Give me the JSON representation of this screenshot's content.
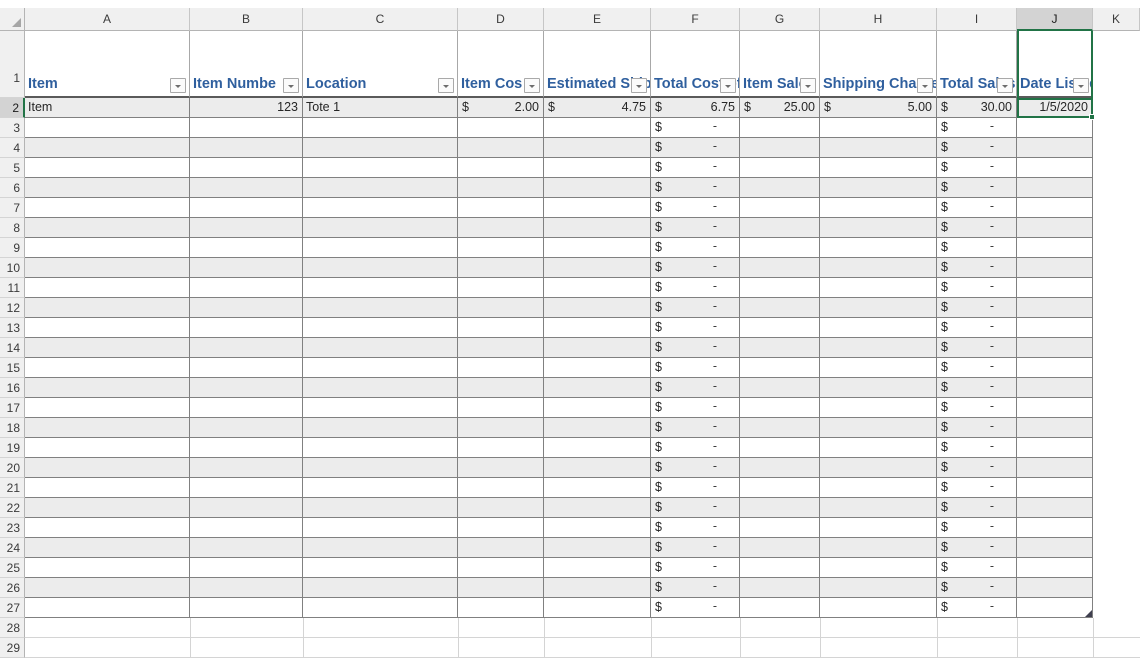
{
  "app": {
    "type": "spreadsheet"
  },
  "grid": {
    "corner_icon": "select-all-triangle-icon",
    "column_letters": [
      "A",
      "B",
      "C",
      "D",
      "E",
      "F",
      "G",
      "H",
      "I",
      "J",
      "K"
    ],
    "selected_column": "J",
    "row_numbers": [
      1,
      2,
      3,
      4,
      5,
      6,
      7,
      8,
      9,
      10,
      11,
      12,
      13,
      14,
      15,
      16,
      17,
      18,
      19,
      20,
      21,
      22,
      23,
      24,
      25,
      26,
      27,
      28,
      29
    ],
    "selected_row": 2
  },
  "table": {
    "headers": [
      {
        "col": "A",
        "label": "Item",
        "align": "left",
        "filter": true
      },
      {
        "col": "B",
        "label": "Item Numbe",
        "align": "left",
        "filter": true
      },
      {
        "col": "C",
        "label": "Location",
        "align": "left",
        "filter": true
      },
      {
        "col": "D",
        "label": "Item Cos",
        "align": "left",
        "filter": true
      },
      {
        "col": "E",
        "label": "Estimated Shipping Costs",
        "align": "right",
        "filter": true
      },
      {
        "col": "F",
        "label": "Total Cost of Item",
        "align": "right",
        "filter": true
      },
      {
        "col": "G",
        "label": "Item Sales Price",
        "align": "right",
        "filter": true
      },
      {
        "col": "H",
        "label": "Shipping Charged",
        "align": "right",
        "filter": true
      },
      {
        "col": "I",
        "label": "Total Sales Price",
        "align": "right",
        "filter": true
      },
      {
        "col": "J",
        "label": "Date Listed",
        "align": "center",
        "filter": true
      }
    ],
    "rows": [
      {
        "row": 2,
        "item": "Item",
        "item_number": "123",
        "location": "Tote 1",
        "item_cost": "2.00",
        "estimated_shipping_costs": "4.75",
        "total_cost_of_item": "6.75",
        "item_sales_price": "25.00",
        "shipping_charged": "5.00",
        "total_sales_price": "30.00",
        "date_listed": "1/5/2020"
      },
      {
        "row": 3,
        "item": "",
        "item_number": "",
        "location": "",
        "item_cost": "",
        "estimated_shipping_costs": "",
        "total_cost_of_item": "-",
        "item_sales_price": "",
        "shipping_charged": "",
        "total_sales_price": "-",
        "date_listed": ""
      },
      {
        "row": 4,
        "item": "",
        "item_number": "",
        "location": "",
        "item_cost": "",
        "estimated_shipping_costs": "",
        "total_cost_of_item": "-",
        "item_sales_price": "",
        "shipping_charged": "",
        "total_sales_price": "-",
        "date_listed": ""
      },
      {
        "row": 5,
        "item": "",
        "item_number": "",
        "location": "",
        "item_cost": "",
        "estimated_shipping_costs": "",
        "total_cost_of_item": "-",
        "item_sales_price": "",
        "shipping_charged": "",
        "total_sales_price": "-",
        "date_listed": ""
      },
      {
        "row": 6,
        "item": "",
        "item_number": "",
        "location": "",
        "item_cost": "",
        "estimated_shipping_costs": "",
        "total_cost_of_item": "-",
        "item_sales_price": "",
        "shipping_charged": "",
        "total_sales_price": "-",
        "date_listed": ""
      },
      {
        "row": 7,
        "item": "",
        "item_number": "",
        "location": "",
        "item_cost": "",
        "estimated_shipping_costs": "",
        "total_cost_of_item": "-",
        "item_sales_price": "",
        "shipping_charged": "",
        "total_sales_price": "-",
        "date_listed": ""
      },
      {
        "row": 8,
        "item": "",
        "item_number": "",
        "location": "",
        "item_cost": "",
        "estimated_shipping_costs": "",
        "total_cost_of_item": "-",
        "item_sales_price": "",
        "shipping_charged": "",
        "total_sales_price": "-",
        "date_listed": ""
      },
      {
        "row": 9,
        "item": "",
        "item_number": "",
        "location": "",
        "item_cost": "",
        "estimated_shipping_costs": "",
        "total_cost_of_item": "-",
        "item_sales_price": "",
        "shipping_charged": "",
        "total_sales_price": "-",
        "date_listed": ""
      },
      {
        "row": 10,
        "item": "",
        "item_number": "",
        "location": "",
        "item_cost": "",
        "estimated_shipping_costs": "",
        "total_cost_of_item": "-",
        "item_sales_price": "",
        "shipping_charged": "",
        "total_sales_price": "-",
        "date_listed": ""
      },
      {
        "row": 11,
        "item": "",
        "item_number": "",
        "location": "",
        "item_cost": "",
        "estimated_shipping_costs": "",
        "total_cost_of_item": "-",
        "item_sales_price": "",
        "shipping_charged": "",
        "total_sales_price": "-",
        "date_listed": ""
      },
      {
        "row": 12,
        "item": "",
        "item_number": "",
        "location": "",
        "item_cost": "",
        "estimated_shipping_costs": "",
        "total_cost_of_item": "-",
        "item_sales_price": "",
        "shipping_charged": "",
        "total_sales_price": "-",
        "date_listed": ""
      },
      {
        "row": 13,
        "item": "",
        "item_number": "",
        "location": "",
        "item_cost": "",
        "estimated_shipping_costs": "",
        "total_cost_of_item": "-",
        "item_sales_price": "",
        "shipping_charged": "",
        "total_sales_price": "-",
        "date_listed": ""
      },
      {
        "row": 14,
        "item": "",
        "item_number": "",
        "location": "",
        "item_cost": "",
        "estimated_shipping_costs": "",
        "total_cost_of_item": "-",
        "item_sales_price": "",
        "shipping_charged": "",
        "total_sales_price": "-",
        "date_listed": ""
      },
      {
        "row": 15,
        "item": "",
        "item_number": "",
        "location": "",
        "item_cost": "",
        "estimated_shipping_costs": "",
        "total_cost_of_item": "-",
        "item_sales_price": "",
        "shipping_charged": "",
        "total_sales_price": "-",
        "date_listed": ""
      },
      {
        "row": 16,
        "item": "",
        "item_number": "",
        "location": "",
        "item_cost": "",
        "estimated_shipping_costs": "",
        "total_cost_of_item": "-",
        "item_sales_price": "",
        "shipping_charged": "",
        "total_sales_price": "-",
        "date_listed": ""
      },
      {
        "row": 17,
        "item": "",
        "item_number": "",
        "location": "",
        "item_cost": "",
        "estimated_shipping_costs": "",
        "total_cost_of_item": "-",
        "item_sales_price": "",
        "shipping_charged": "",
        "total_sales_price": "-",
        "date_listed": ""
      },
      {
        "row": 18,
        "item": "",
        "item_number": "",
        "location": "",
        "item_cost": "",
        "estimated_shipping_costs": "",
        "total_cost_of_item": "-",
        "item_sales_price": "",
        "shipping_charged": "",
        "total_sales_price": "-",
        "date_listed": ""
      },
      {
        "row": 19,
        "item": "",
        "item_number": "",
        "location": "",
        "item_cost": "",
        "estimated_shipping_costs": "",
        "total_cost_of_item": "-",
        "item_sales_price": "",
        "shipping_charged": "",
        "total_sales_price": "-",
        "date_listed": ""
      },
      {
        "row": 20,
        "item": "",
        "item_number": "",
        "location": "",
        "item_cost": "",
        "estimated_shipping_costs": "",
        "total_cost_of_item": "-",
        "item_sales_price": "",
        "shipping_charged": "",
        "total_sales_price": "-",
        "date_listed": ""
      },
      {
        "row": 21,
        "item": "",
        "item_number": "",
        "location": "",
        "item_cost": "",
        "estimated_shipping_costs": "",
        "total_cost_of_item": "-",
        "item_sales_price": "",
        "shipping_charged": "",
        "total_sales_price": "-",
        "date_listed": ""
      },
      {
        "row": 22,
        "item": "",
        "item_number": "",
        "location": "",
        "item_cost": "",
        "estimated_shipping_costs": "",
        "total_cost_of_item": "-",
        "item_sales_price": "",
        "shipping_charged": "",
        "total_sales_price": "-",
        "date_listed": ""
      },
      {
        "row": 23,
        "item": "",
        "item_number": "",
        "location": "",
        "item_cost": "",
        "estimated_shipping_costs": "",
        "total_cost_of_item": "-",
        "item_sales_price": "",
        "shipping_charged": "",
        "total_sales_price": "-",
        "date_listed": ""
      },
      {
        "row": 24,
        "item": "",
        "item_number": "",
        "location": "",
        "item_cost": "",
        "estimated_shipping_costs": "",
        "total_cost_of_item": "-",
        "item_sales_price": "",
        "shipping_charged": "",
        "total_sales_price": "-",
        "date_listed": ""
      },
      {
        "row": 25,
        "item": "",
        "item_number": "",
        "location": "",
        "item_cost": "",
        "estimated_shipping_costs": "",
        "total_cost_of_item": "-",
        "item_sales_price": "",
        "shipping_charged": "",
        "total_sales_price": "-",
        "date_listed": ""
      },
      {
        "row": 26,
        "item": "",
        "item_number": "",
        "location": "",
        "item_cost": "",
        "estimated_shipping_costs": "",
        "total_cost_of_item": "-",
        "item_sales_price": "",
        "shipping_charged": "",
        "total_sales_price": "-",
        "date_listed": ""
      },
      {
        "row": 27,
        "item": "",
        "item_number": "",
        "location": "",
        "item_cost": "",
        "estimated_shipping_costs": "",
        "total_cost_of_item": "-",
        "item_sales_price": "",
        "shipping_charged": "",
        "total_sales_price": "-",
        "date_listed": ""
      }
    ],
    "currency_symbol": "$",
    "empty_currency_display": "-"
  },
  "selection": {
    "active_cell": "J2",
    "active_value": "1/5/2020"
  },
  "colors": {
    "header_text": "#2f5f9e",
    "selection": "#217346",
    "band": "#ececec",
    "gridline": "#808080"
  }
}
